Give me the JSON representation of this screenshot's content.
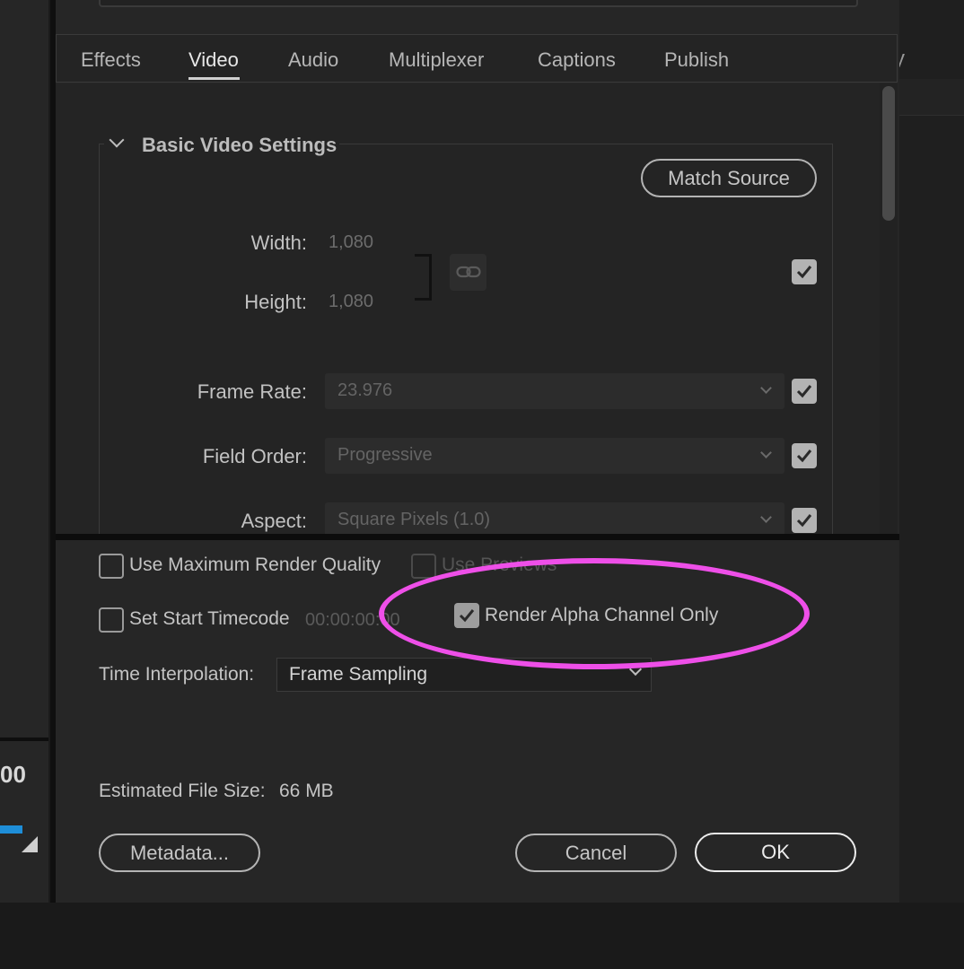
{
  "background": {
    "left_timecode_fragment": "00",
    "right_tab_fragment": "y",
    "accent_color": "#1e8ed8"
  },
  "tabs": [
    {
      "label": "Effects",
      "active": false
    },
    {
      "label": "Video",
      "active": true
    },
    {
      "label": "Audio",
      "active": false
    },
    {
      "label": "Multiplexer",
      "active": false
    },
    {
      "label": "Captions",
      "active": false
    },
    {
      "label": "Publish",
      "active": false
    }
  ],
  "basic_video": {
    "title": "Basic Video Settings",
    "match_source_label": "Match Source",
    "width_label": "Width:",
    "width_value": "1,080",
    "height_label": "Height:",
    "height_value": "1,080",
    "link_icon": "link-icon",
    "frame_rate_label": "Frame Rate:",
    "frame_rate_value": "23.976",
    "field_order_label": "Field Order:",
    "field_order_value": "Progressive",
    "aspect_label": "Aspect:",
    "aspect_value": "Square Pixels (1.0)"
  },
  "options": {
    "max_render_quality_label": "Use Maximum Render Quality",
    "max_render_quality_checked": false,
    "use_previews_label": "Use Previews",
    "use_previews_checked": false,
    "set_start_timecode_label": "Set Start Timecode",
    "set_start_timecode_checked": false,
    "start_timecode_value": "00:00:00:00",
    "render_alpha_label": "Render Alpha Channel Only",
    "render_alpha_checked": true,
    "time_interpolation_label": "Time Interpolation:",
    "time_interpolation_value": "Frame Sampling"
  },
  "estimate": {
    "label": "Estimated File Size:",
    "value": "66 MB"
  },
  "buttons": {
    "metadata": "Metadata...",
    "cancel": "Cancel",
    "ok": "OK"
  },
  "highlight_color": "#ee4fe8"
}
